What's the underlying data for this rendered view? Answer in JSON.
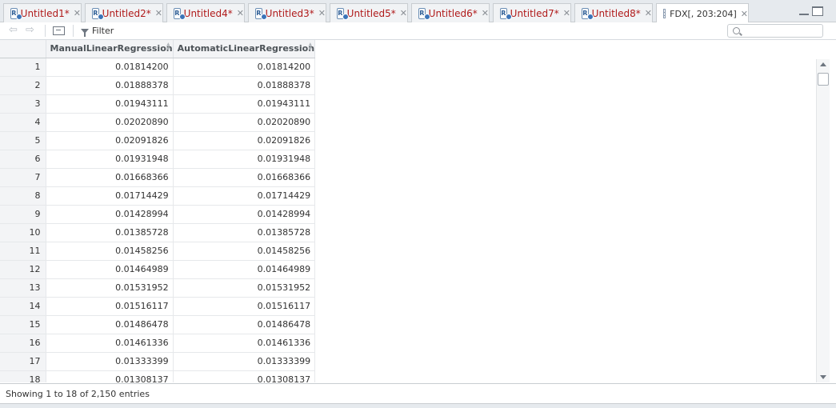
{
  "tabs": [
    {
      "label": "Untitled1*",
      "type": "r-script"
    },
    {
      "label": "Untitled2*",
      "type": "r-script"
    },
    {
      "label": "Untitled4*",
      "type": "r-script"
    },
    {
      "label": "Untitled3*",
      "type": "r-script"
    },
    {
      "label": "Untitled5*",
      "type": "r-script"
    },
    {
      "label": "Untitled6*",
      "type": "r-script"
    },
    {
      "label": "Untitled7*",
      "type": "r-script"
    },
    {
      "label": "Untitled8*",
      "type": "r-script"
    },
    {
      "label": "FDX[, 203:204]",
      "type": "data-view",
      "active": true
    }
  ],
  "toolbar": {
    "filter_label": "Filter",
    "search_placeholder": ""
  },
  "table": {
    "columns": [
      "ManualLinearRegression",
      "AutomaticLinearRegression"
    ],
    "rows": [
      [
        "1",
        "0.01814200",
        "0.01814200"
      ],
      [
        "2",
        "0.01888378",
        "0.01888378"
      ],
      [
        "3",
        "0.01943111",
        "0.01943111"
      ],
      [
        "4",
        "0.02020890",
        "0.02020890"
      ],
      [
        "5",
        "0.02091826",
        "0.02091826"
      ],
      [
        "6",
        "0.01931948",
        "0.01931948"
      ],
      [
        "7",
        "0.01668366",
        "0.01668366"
      ],
      [
        "8",
        "0.01714429",
        "0.01714429"
      ],
      [
        "9",
        "0.01428994",
        "0.01428994"
      ],
      [
        "10",
        "0.01385728",
        "0.01385728"
      ],
      [
        "11",
        "0.01458256",
        "0.01458256"
      ],
      [
        "12",
        "0.01464989",
        "0.01464989"
      ],
      [
        "13",
        "0.01531952",
        "0.01531952"
      ],
      [
        "14",
        "0.01516117",
        "0.01516117"
      ],
      [
        "15",
        "0.01486478",
        "0.01486478"
      ],
      [
        "16",
        "0.01461336",
        "0.01461336"
      ],
      [
        "17",
        "0.01333399",
        "0.01333399"
      ],
      [
        "18",
        "0.01308137",
        "0.01308137"
      ]
    ]
  },
  "status": {
    "text": "Showing 1 to 18 of 2,150 entries"
  },
  "colors": {
    "modified_tab_text": "#b01a1a",
    "tabbar_bg": "#e6eaee"
  }
}
